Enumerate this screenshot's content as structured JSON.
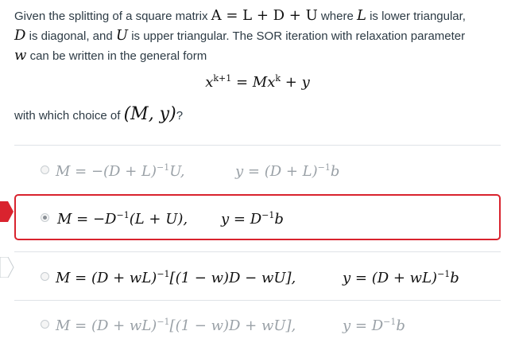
{
  "question": {
    "line1_pre": "Given the splitting of a square matrix ",
    "line1_math": "A = L + D + U",
    "line1_mid": " where ",
    "line1_L": "L",
    "line1_post": " is lower triangular,",
    "line2_D": "D",
    "line2_mid": " is diagonal, and ",
    "line2_U": "U",
    "line2_post": " is upper triangular.  The SOR iteration with relaxation parameter",
    "line3_w": "w",
    "line3_post": " can be written in the general form",
    "equation_lhs": "x",
    "equation_lhs_sup": "k+1",
    "equation_mid": " = Mx",
    "equation_mid_sup": "k",
    "equation_rhs": " + y",
    "with_text": "with which choice of ",
    "with_math": "(M, y)",
    "with_q": "?"
  },
  "options": [
    {
      "M": "M = −(D + L)",
      "M_sup": "−1",
      "M_tail": "U,",
      "y": "y = (D + L)",
      "y_sup": "−1",
      "y_tail": "b",
      "selected": false
    },
    {
      "M": "M = −D",
      "M_sup": "−1",
      "M_tail": "(L + U),",
      "y": "y = D",
      "y_sup": "−1",
      "y_tail": "b",
      "selected": true
    },
    {
      "M": "M = (D + wL)",
      "M_sup": "−1",
      "M_tail": "[(1 − w)D − wU],",
      "y": "y = (D + wL)",
      "y_sup": "−1",
      "y_tail": "b",
      "selected": false
    },
    {
      "M": "M = (D + wL)",
      "M_sup": "−1",
      "M_tail": "[(1 − w)D + wU],",
      "y": "y = D",
      "y_sup": "−1",
      "y_tail": "b",
      "selected": false
    }
  ],
  "colors": {
    "selected_border": "#d9232e",
    "text": "#2d3b45"
  }
}
